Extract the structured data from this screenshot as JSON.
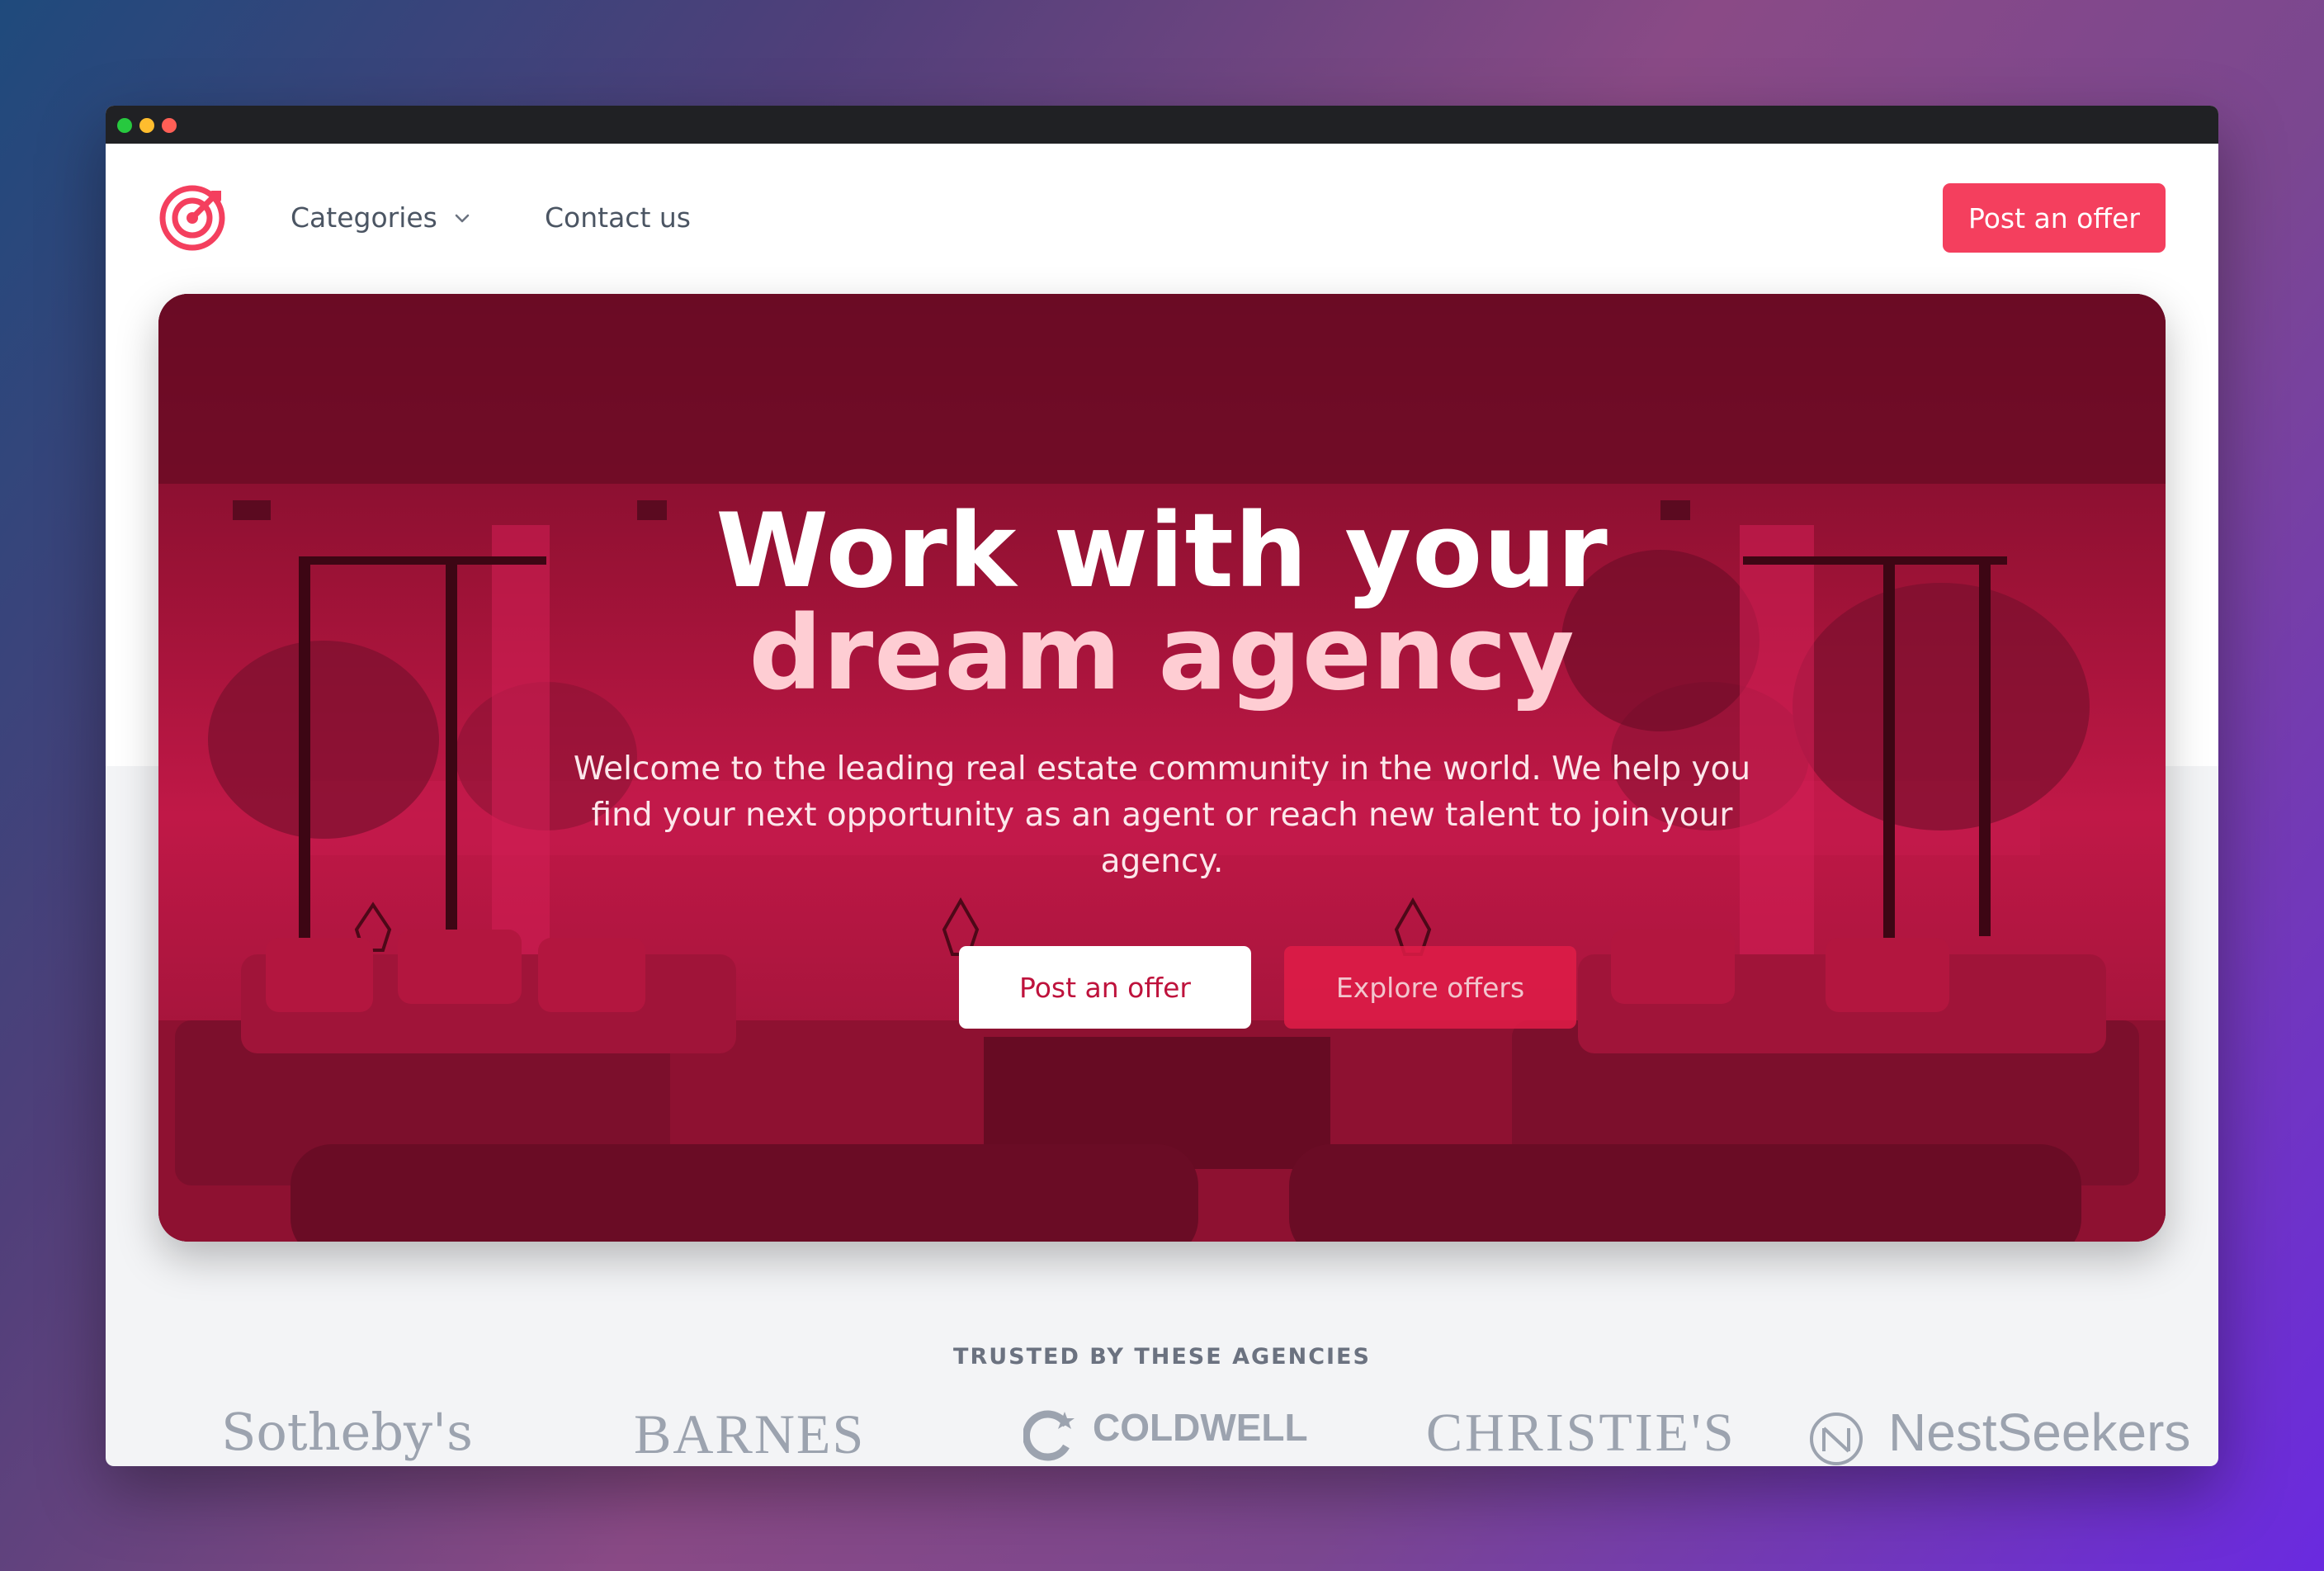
{
  "colors": {
    "accent": "#f43f5e",
    "hero_overlay": "#b01440",
    "hero_title_light": "#fecdd3",
    "muted_text": "#6b7280"
  },
  "window": {
    "controls": [
      "green-dot",
      "yellow-dot",
      "red-dot"
    ]
  },
  "nav": {
    "logo_icon": "target-icon",
    "categories_label": "Categories",
    "categories_icon": "chevron-down-icon",
    "contact_label": "Contact us",
    "post_offer_label": "Post an offer"
  },
  "hero": {
    "title_line1": "Work with your",
    "title_line2": "dream agency",
    "description": "Welcome to the leading real estate community in the world. We help you find your next opportunity as an agent or reach new talent to join your agency.",
    "primary_button": "Post an offer",
    "secondary_button": "Explore offers"
  },
  "trusted": {
    "heading": "TRUSTED BY THESE AGENCIES",
    "agencies": [
      "Sotheby's",
      "BARNES",
      "COLDWELL",
      "CHRISTIE'S",
      "NestSeekers"
    ]
  }
}
